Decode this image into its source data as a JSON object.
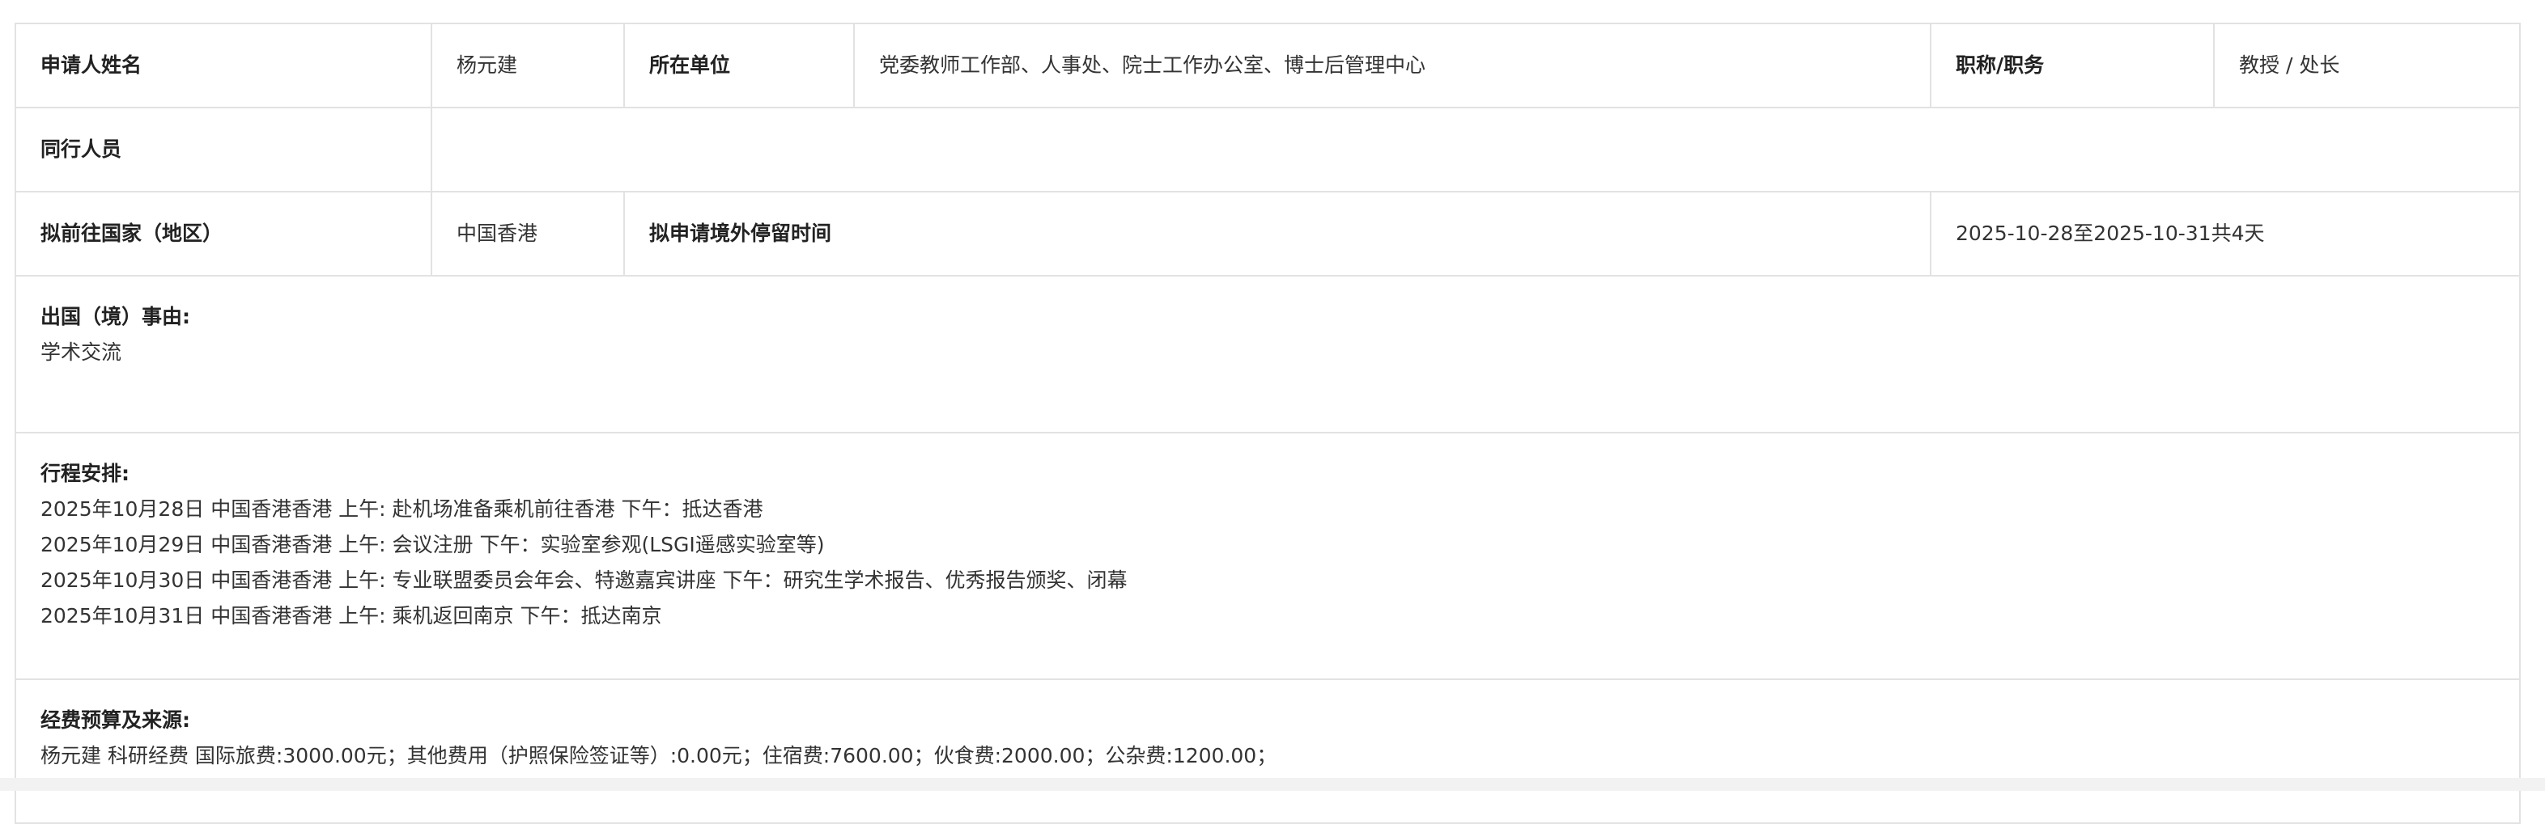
{
  "applicant": {
    "name_label": "申请人姓名",
    "name": "杨元建",
    "unit_label": "所在单位",
    "unit": "党委教师工作部、人事处、院士工作办公室、博士后管理中心",
    "title_label": "职称/职务",
    "title": "教授 / 处长"
  },
  "companions": {
    "label": "同行人员",
    "value": ""
  },
  "destination": {
    "label": "拟前往国家（地区）",
    "value": "中国香港",
    "stay_label": "拟申请境外停留时间",
    "stay_value": "2025-10-28至2025-10-31共4天"
  },
  "reason": {
    "label": "出国（境）事由:",
    "value": "学术交流"
  },
  "itinerary": {
    "label": "行程安排:",
    "lines": [
      "2025年10月28日 中国香港香港 上午:  赴机场准备乘机前往香港 下午：抵达香港",
      "2025年10月29日 中国香港香港 上午:  会议注册 下午：实验室参观(LSGI遥感实验室等)",
      "2025年10月30日 中国香港香港 上午:  专业联盟委员会年会、特邀嘉宾讲座 下午：研究生学术报告、优秀报告颁奖、闭幕",
      "2025年10月31日 中国香港香港 上午:  乘机返回南京 下午：抵达南京"
    ]
  },
  "budget": {
    "label": "经费预算及来源:",
    "value": "杨元建 科研经费 国际旅费:3000.00元；其他费用（护照保险签证等）:0.00元；住宿费:7600.00；伙食费:2000.00；公杂费:1200.00；"
  }
}
